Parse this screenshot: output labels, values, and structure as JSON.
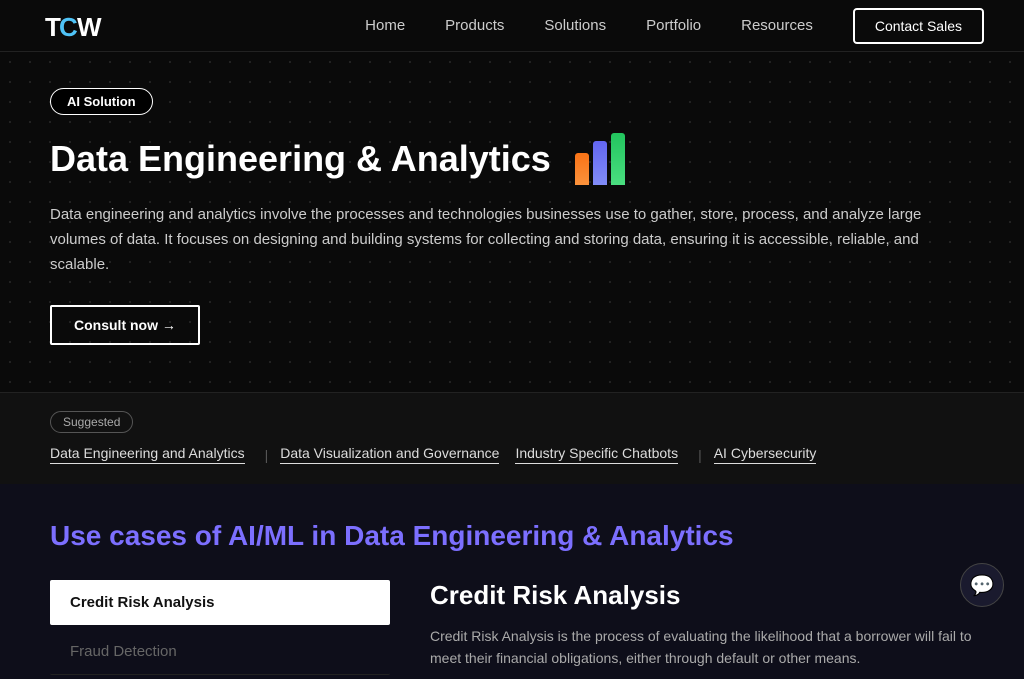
{
  "nav": {
    "logo_text": "TCW",
    "links": [
      {
        "label": "Home",
        "id": "home"
      },
      {
        "label": "Products",
        "id": "products"
      },
      {
        "label": "Solutions",
        "id": "solutions"
      },
      {
        "label": "Portfolio",
        "id": "portfolio"
      },
      {
        "label": "Resources",
        "id": "resources"
      }
    ],
    "contact_label": "Contact Sales"
  },
  "hero": {
    "badge": "AI Solution",
    "title": "Data Engineering & Analytics",
    "description": "Data engineering and analytics involve the processes and technologies businesses use to gather, store, process, and analyze large volumes of data. It focuses on designing and building systems for collecting and storing data, ensuring it is accessible, reliable, and scalable.",
    "consult_label": "Consult now →"
  },
  "suggested": {
    "badge": "Suggested",
    "links": [
      {
        "label": "Data Engineering and Analytics"
      },
      {
        "label": "Data Visualization and Governance"
      },
      {
        "label": "Industry Specific Chatbots"
      },
      {
        "label": "AI Cybersecurity"
      }
    ]
  },
  "use_cases": {
    "section_title": "Use cases of AI/ML in Data Engineering & Analytics",
    "items": [
      {
        "label": "Credit Risk Analysis",
        "active": true
      },
      {
        "label": "Fraud Detection",
        "active": false
      }
    ],
    "detail": {
      "title": "Credit Risk Analysis",
      "description": "Credit Risk Analysis is the process of evaluating the likelihood that a borrower will fail to meet their financial obligations, either through default or other means."
    }
  },
  "chat": {
    "icon": "💬"
  }
}
